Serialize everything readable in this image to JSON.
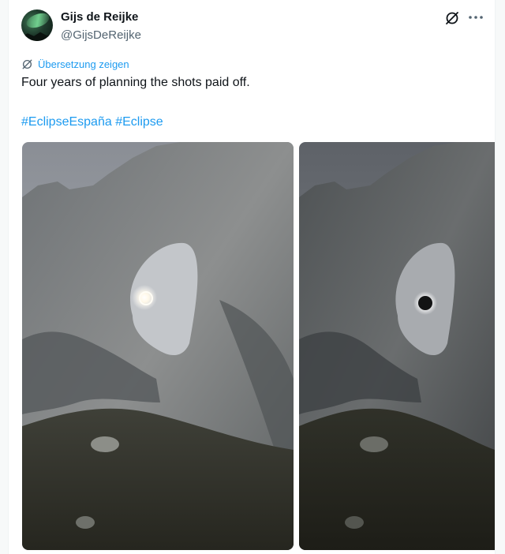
{
  "tweet": {
    "author_name": "Gijs de Reijke",
    "author_handle": "@GijsDeReijke",
    "translate_label": "Übersetzung zeigen",
    "text": "Four years of planning the shots paid off.",
    "hashtags": [
      "#EclipseEspaña",
      "#Eclipse"
    ],
    "icons": {
      "avatar": "aurora-mountain-avatar",
      "grok": "grok-icon",
      "more": "more-icon",
      "translate": "translate-icon"
    },
    "photos": [
      {
        "subject": "rock arch framing diamond-ring eclipse"
      },
      {
        "subject": "rock arch framing total solar eclipse corona"
      }
    ]
  },
  "colors": {
    "link": "#1d9bf0",
    "text": "#0f1419",
    "secondary": "#536471"
  }
}
